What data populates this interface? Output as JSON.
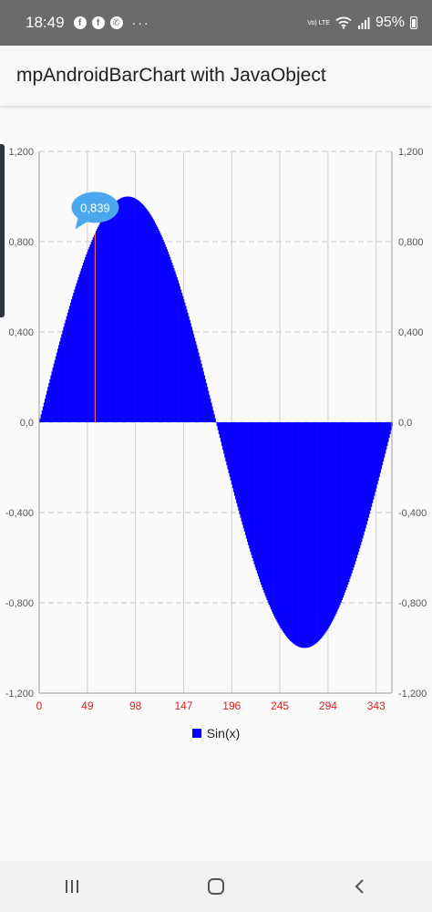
{
  "status_bar": {
    "time": "18:49",
    "notifications": [
      "facebook-icon",
      "facebook-icon",
      "whatsapp-icon"
    ],
    "more": "···",
    "volte": "Vo) LTE",
    "battery": "95%"
  },
  "app_bar": {
    "title": "mpAndroidBarChart with JavaObject"
  },
  "chart_data": {
    "type": "bar",
    "function": "sin(x)",
    "x_start": 0,
    "x_end": 359,
    "x_step": 1,
    "xlim": [
      0,
      359
    ],
    "ylim": [
      -1.2,
      1.2
    ],
    "x_ticks": [
      "0",
      "49",
      "98",
      "147",
      "196",
      "245",
      "294",
      "343"
    ],
    "y_ticks_left": [
      "1,200",
      "0,800",
      "0,400",
      "0,0",
      "-0,400",
      "-0,800",
      "-1,200"
    ],
    "y_ticks_right": [
      "1,200",
      "0,800",
      "0,400",
      "0,0",
      "-0,400",
      "-0,800",
      "-1,200"
    ],
    "series": [
      {
        "name": "Sin(x)",
        "color": "#0a00ff"
      }
    ],
    "highlight": {
      "x": 57,
      "value": 0.839,
      "label": "0,839",
      "marker_color": "#4aa8ee",
      "line_color": "#ff6b6b"
    },
    "x_tick_color": "#e02020",
    "grid": true,
    "legend": "bottom-center"
  },
  "legend": {
    "label": "Sin(x)"
  },
  "nav_bar": {
    "buttons": [
      "recent-apps-icon",
      "home-icon",
      "back-icon"
    ]
  }
}
